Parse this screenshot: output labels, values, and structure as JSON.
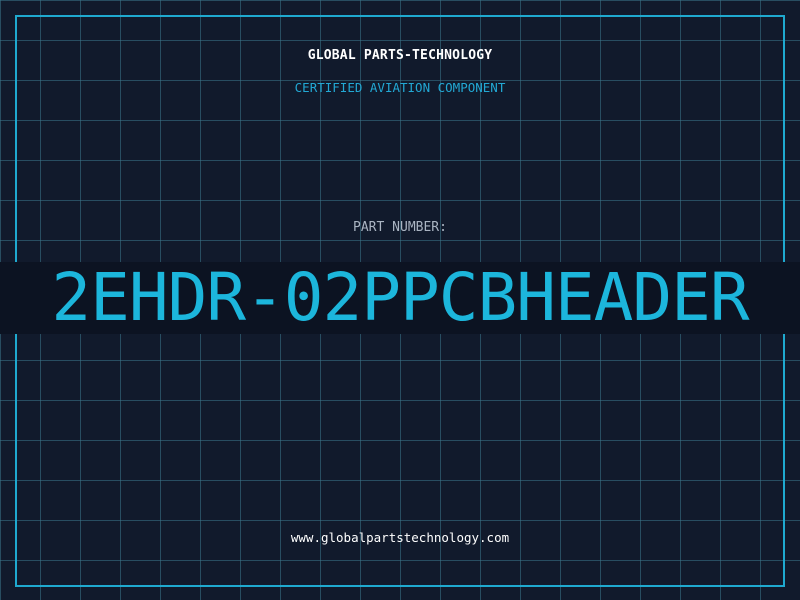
{
  "header": {
    "company": "GLOBAL PARTS-TECHNOLOGY",
    "subtitle": "CERTIFIED AVIATION COMPONENT"
  },
  "part": {
    "label": "PART NUMBER:",
    "number": "2EHDR-02PPCBHEADER"
  },
  "footer": {
    "website": "www.globalpartstechnology.com"
  },
  "colors": {
    "background": "#111a2c",
    "grid": "#3a768c",
    "accent": "#1cb6dc",
    "band": "#0c1322",
    "label": "#aab4c2",
    "text": "#ffffff"
  }
}
